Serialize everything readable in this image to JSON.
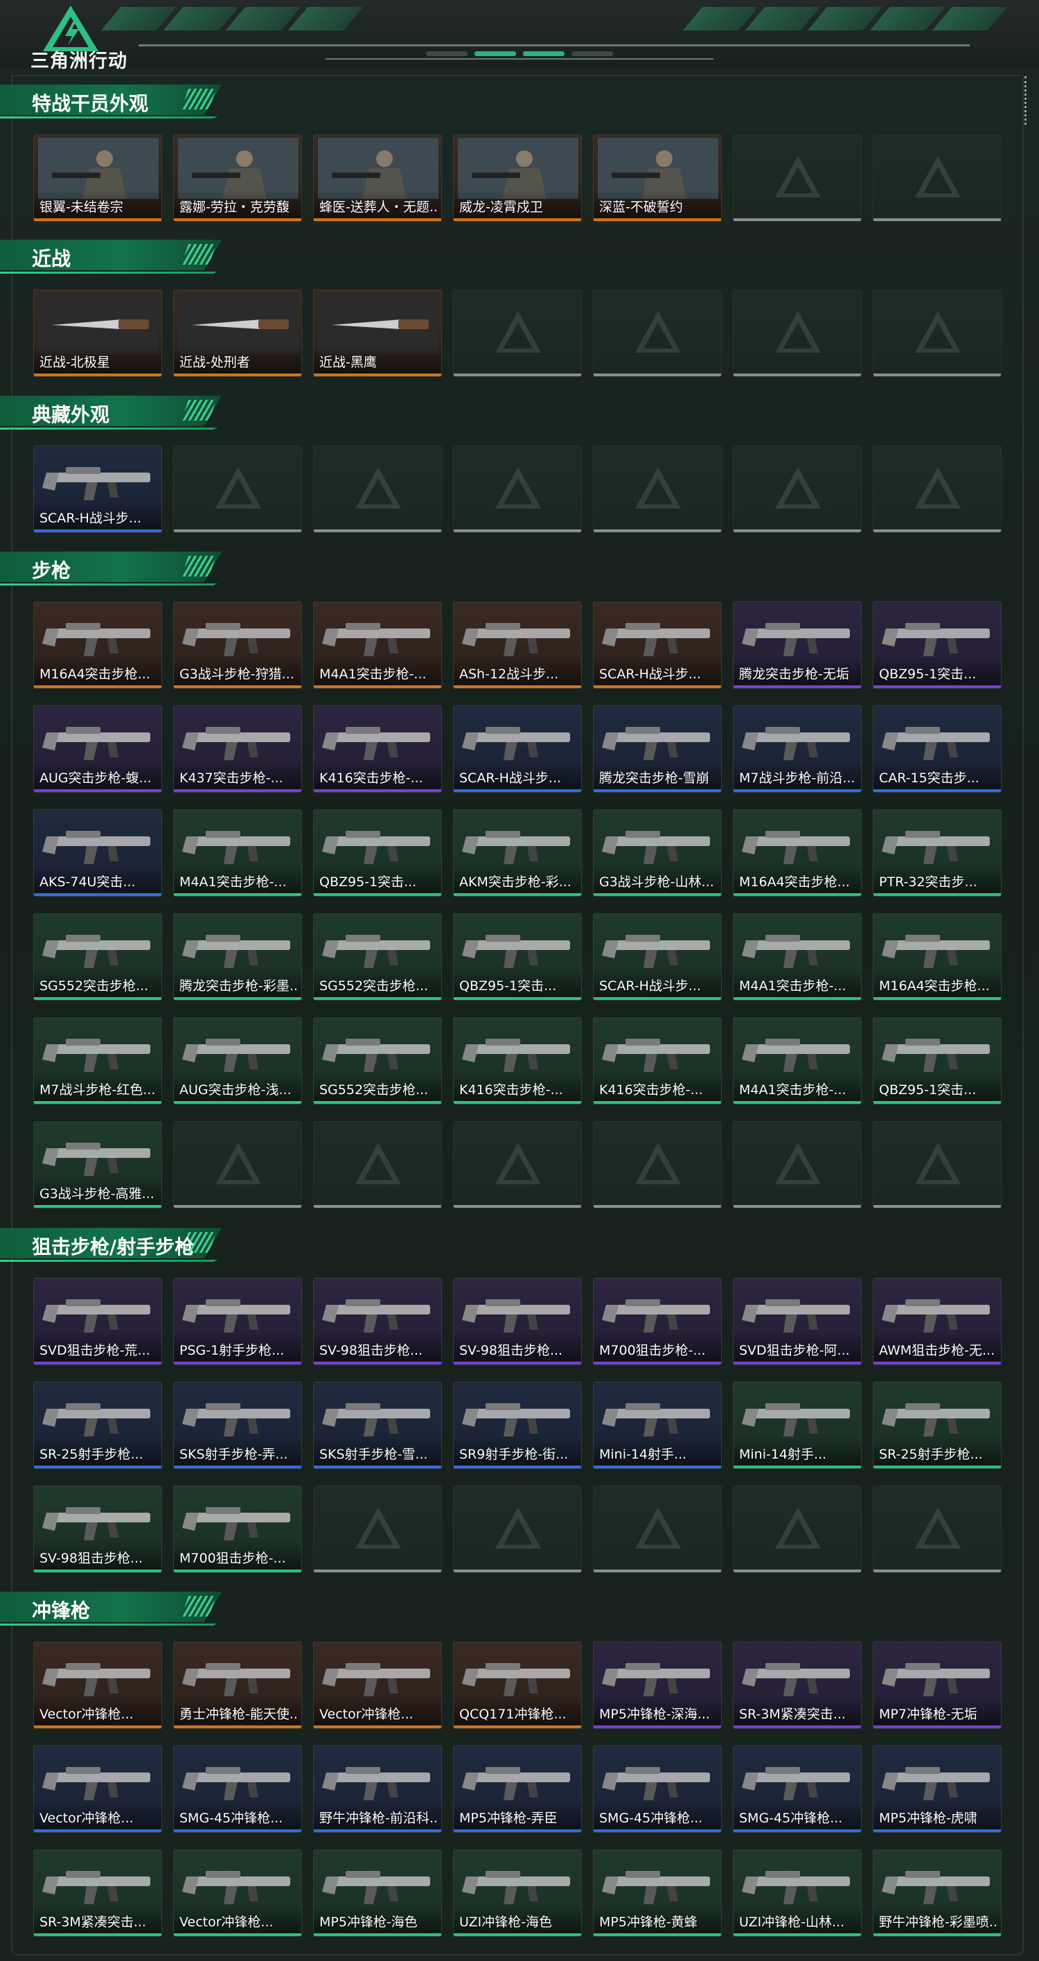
{
  "app": {
    "logo_text": "三角洲行动"
  },
  "colors": {
    "orange": "#d2731c",
    "purple": "#7b3ed6",
    "blue": "#2f6fe0",
    "green": "#29c27c",
    "empty": "#8a908d"
  },
  "sections": [
    {
      "title": "特战干员外观",
      "rows": [
        [
          {
            "label": "银翼-未结卷宗",
            "rarity": "orange"
          },
          {
            "label": "露娜-劳拉・克劳馥",
            "rarity": "orange"
          },
          {
            "label": "蜂医-送葬人・无题...",
            "rarity": "orange"
          },
          {
            "label": "威龙-凌霄戍卫",
            "rarity": "orange"
          },
          {
            "label": "深蓝-不破誓约",
            "rarity": "orange"
          },
          null,
          null
        ]
      ]
    },
    {
      "title": "近战",
      "rows": [
        [
          {
            "label": "近战-北极星",
            "rarity": "orange"
          },
          {
            "label": "近战-处刑者",
            "rarity": "orange"
          },
          {
            "label": "近战-黑鹰",
            "rarity": "orange"
          },
          null,
          null,
          null,
          null
        ]
      ]
    },
    {
      "title": "典藏外观",
      "rows": [
        [
          {
            "label": "SCAR-H战斗步...",
            "rarity": "blue"
          },
          null,
          null,
          null,
          null,
          null,
          null
        ]
      ]
    },
    {
      "title": "步枪",
      "rows": [
        [
          {
            "label": "M16A4突击步枪...",
            "rarity": "orange"
          },
          {
            "label": "G3战斗步枪-狩猎...",
            "rarity": "orange"
          },
          {
            "label": "M4A1突击步枪-...",
            "rarity": "orange"
          },
          {
            "label": "ASh-12战斗步...",
            "rarity": "orange"
          },
          {
            "label": "SCAR-H战斗步...",
            "rarity": "orange"
          },
          {
            "label": "腾龙突击步枪-无垢",
            "rarity": "purple"
          },
          {
            "label": "QBZ95-1突击...",
            "rarity": "purple"
          }
        ],
        [
          {
            "label": "AUG突击步枪-蝮...",
            "rarity": "purple"
          },
          {
            "label": "K437突击步枪-...",
            "rarity": "purple"
          },
          {
            "label": "K416突击步枪-...",
            "rarity": "purple"
          },
          {
            "label": "SCAR-H战斗步...",
            "rarity": "blue"
          },
          {
            "label": "腾龙突击步枪-雪崩",
            "rarity": "blue"
          },
          {
            "label": "M7战斗步枪-前沿...",
            "rarity": "blue"
          },
          {
            "label": "CAR-15突击步...",
            "rarity": "blue"
          }
        ],
        [
          {
            "label": "AKS-74U突击...",
            "rarity": "blue"
          },
          {
            "label": "M4A1突击步枪-...",
            "rarity": "green"
          },
          {
            "label": "QBZ95-1突击...",
            "rarity": "green"
          },
          {
            "label": "AKM突击步枪-彩...",
            "rarity": "green"
          },
          {
            "label": "G3战斗步枪-山林...",
            "rarity": "green"
          },
          {
            "label": "M16A4突击步枪...",
            "rarity": "green"
          },
          {
            "label": "PTR-32突击步...",
            "rarity": "green"
          }
        ],
        [
          {
            "label": "SG552突击步枪...",
            "rarity": "green"
          },
          {
            "label": "腾龙突击步枪-彩墨...",
            "rarity": "green"
          },
          {
            "label": "SG552突击步枪...",
            "rarity": "green"
          },
          {
            "label": "QBZ95-1突击...",
            "rarity": "green"
          },
          {
            "label": "SCAR-H战斗步...",
            "rarity": "green"
          },
          {
            "label": "M4A1突击步枪-...",
            "rarity": "green"
          },
          {
            "label": "M16A4突击步枪...",
            "rarity": "green"
          }
        ],
        [
          {
            "label": "M7战斗步枪-红色...",
            "rarity": "green"
          },
          {
            "label": "AUG突击步枪-浅...",
            "rarity": "green"
          },
          {
            "label": "SG552突击步枪...",
            "rarity": "green"
          },
          {
            "label": "K416突击步枪-...",
            "rarity": "green"
          },
          {
            "label": "K416突击步枪-...",
            "rarity": "green"
          },
          {
            "label": "M4A1突击步枪-...",
            "rarity": "green"
          },
          {
            "label": "QBZ95-1突击...",
            "rarity": "green"
          }
        ],
        [
          {
            "label": "G3战斗步枪-高雅...",
            "rarity": "green"
          },
          null,
          null,
          null,
          null,
          null,
          null
        ]
      ]
    },
    {
      "title": "狙击步枪/射手步枪",
      "rows": [
        [
          {
            "label": "SVD狙击步枪-荒...",
            "rarity": "purple"
          },
          {
            "label": "PSG-1射手步枪...",
            "rarity": "purple"
          },
          {
            "label": "SV-98狙击步枪...",
            "rarity": "purple"
          },
          {
            "label": "SV-98狙击步枪...",
            "rarity": "purple"
          },
          {
            "label": "M700狙击步枪-...",
            "rarity": "purple"
          },
          {
            "label": "SVD狙击步枪-阿...",
            "rarity": "purple"
          },
          {
            "label": "AWM狙击步枪-无...",
            "rarity": "purple"
          }
        ],
        [
          {
            "label": "SR-25射手步枪...",
            "rarity": "blue"
          },
          {
            "label": "SKS射手步枪-弄...",
            "rarity": "blue"
          },
          {
            "label": "SKS射手步枪-雪...",
            "rarity": "blue"
          },
          {
            "label": "SR9射手步枪-街...",
            "rarity": "blue"
          },
          {
            "label": "Mini-14射手...",
            "rarity": "blue"
          },
          {
            "label": "Mini-14射手...",
            "rarity": "green"
          },
          {
            "label": "SR-25射手步枪...",
            "rarity": "green"
          }
        ],
        [
          {
            "label": "SV-98狙击步枪...",
            "rarity": "green"
          },
          {
            "label": "M700狙击步枪-...",
            "rarity": "green"
          },
          null,
          null,
          null,
          null,
          null
        ]
      ]
    },
    {
      "title": "冲锋枪",
      "rows": [
        [
          {
            "label": "Vector冲锋枪...",
            "rarity": "orange"
          },
          {
            "label": "勇士冲锋枪-能天使...",
            "rarity": "orange"
          },
          {
            "label": "Vector冲锋枪...",
            "rarity": "orange"
          },
          {
            "label": "QCQ171冲锋枪...",
            "rarity": "orange"
          },
          {
            "label": "MP5冲锋枪-深海...",
            "rarity": "purple"
          },
          {
            "label": "SR-3M紧凑突击...",
            "rarity": "purple"
          },
          {
            "label": "MP7冲锋枪-无垢",
            "rarity": "purple"
          }
        ],
        [
          {
            "label": "Vector冲锋枪...",
            "rarity": "blue"
          },
          {
            "label": "SMG-45冲锋枪...",
            "rarity": "blue"
          },
          {
            "label": "野牛冲锋枪-前沿科...",
            "rarity": "blue"
          },
          {
            "label": "MP5冲锋枪-弄臣",
            "rarity": "blue"
          },
          {
            "label": "SMG-45冲锋枪...",
            "rarity": "blue"
          },
          {
            "label": "SMG-45冲锋枪...",
            "rarity": "blue"
          },
          {
            "label": "MP5冲锋枪-虎啸",
            "rarity": "blue"
          }
        ],
        [
          {
            "label": "SR-3M紧凑突击...",
            "rarity": "green"
          },
          {
            "label": "Vector冲锋枪...",
            "rarity": "green"
          },
          {
            "label": "MP5冲锋枪-海色",
            "rarity": "green"
          },
          {
            "label": "UZI冲锋枪-海色",
            "rarity": "green"
          },
          {
            "label": "MP5冲锋枪-黄蜂",
            "rarity": "green"
          },
          {
            "label": "UZI冲锋枪-山林...",
            "rarity": "green"
          },
          {
            "label": "野牛冲锋枪-彩墨喷...",
            "rarity": "green"
          }
        ]
      ]
    }
  ]
}
